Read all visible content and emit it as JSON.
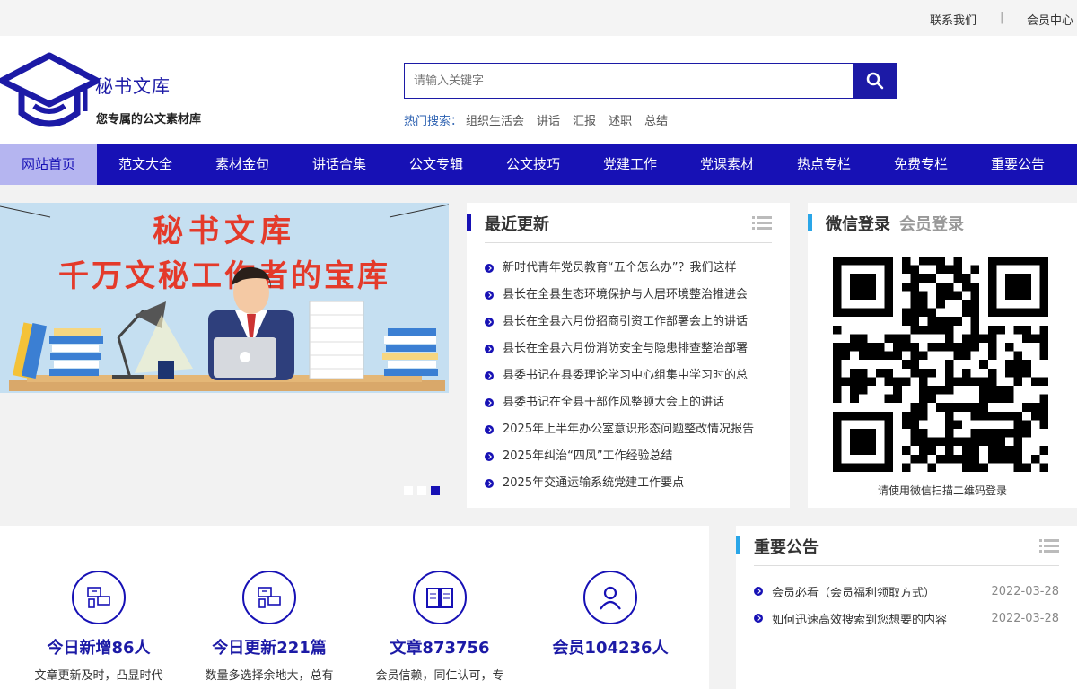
{
  "topbar": {
    "contact": "联系我们",
    "separator": "|",
    "member_center": "会员中心"
  },
  "logo": {
    "title": "秘书文库",
    "subtitle": "您专属的公文素材库",
    "icon": "graduation-cap-icon"
  },
  "search": {
    "placeholder": "请输入关键字",
    "button_icon": "search-icon"
  },
  "hot": {
    "label": "热门搜索：",
    "keywords": [
      "组织生活会",
      "讲话",
      "汇报",
      "述职",
      "总结"
    ]
  },
  "nav": {
    "items": [
      "网站首页",
      "范文大全",
      "素材金句",
      "讲话合集",
      "公文专辑",
      "公文技巧",
      "党建工作",
      "党课素材",
      "热点专栏",
      "免费专栏",
      "重要公告"
    ],
    "active_index": 0
  },
  "banner": {
    "line1": "秘书文库",
    "line2": "千万文秘工作者的宝库",
    "slides": 3,
    "active_slide": 3
  },
  "updates": {
    "title": "最近更新",
    "items": [
      "新时代青年党员教育“五个怎么办”？我们这样",
      "县长在全县生态环境保护与人居环境整治推进会",
      "县长在全县六月份招商引资工作部署会上的讲话",
      "县长在全县六月份消防安全与隐患排查整治部署",
      "县委书记在县委理论学习中心组集中学习时的总",
      "县委书记在全县干部作风整顿大会上的讲话",
      "2025年上半年办公室意识形态问题整改情况报告",
      "2025年纠治“四风”工作经验总结",
      "2025年交通运输系统党建工作要点"
    ]
  },
  "login": {
    "tab_wechat": "微信登录",
    "tab_member": "会员登录",
    "hint": "请使用微信扫描二维码登录"
  },
  "stats": [
    {
      "num": "今日新增86人",
      "desc": "文章更新及时，凸显时代",
      "icon": "monitor-devices-icon"
    },
    {
      "num": "今日更新221篇",
      "desc": "数量多选择余地大，总有",
      "icon": "monitor-devices-icon"
    },
    {
      "num": "文章873756",
      "desc": "会员信赖，同仁认可，专",
      "icon": "book-icon"
    },
    {
      "num": "会员104236人",
      "desc": "",
      "icon": "user-icon"
    }
  ],
  "notice": {
    "title": "重要公告",
    "items": [
      {
        "title": "会员必看（会员福利领取方式）",
        "date": "2022-03-28"
      },
      {
        "title": "如何迅速高效搜索到您想要的内容",
        "date": "2022-03-28"
      }
    ]
  },
  "colors": {
    "brand": "#1711b5",
    "accent": "#2aa6e8",
    "banner_bg": "#c5dff1",
    "banner_text": "#e43a2a"
  }
}
